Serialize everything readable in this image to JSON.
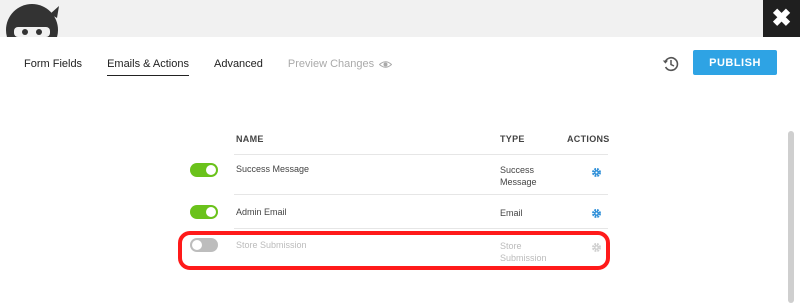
{
  "header": {
    "close_glyph": "✖"
  },
  "tabs": [
    {
      "label": "Form Fields"
    },
    {
      "label": "Emails & Actions"
    },
    {
      "label": "Advanced"
    },
    {
      "label": "Preview Changes"
    }
  ],
  "toolbar": {
    "publish_label": "PUBLISH"
  },
  "table": {
    "headers": {
      "name": "NAME",
      "type": "TYPE",
      "actions": "ACTIONS"
    },
    "rows": [
      {
        "enabled": true,
        "name": "Success Message",
        "type_line1": "Success",
        "type_line2": "Message"
      },
      {
        "enabled": true,
        "name": "Admin Email",
        "type_line1": "Email",
        "type_line2": ""
      },
      {
        "enabled": false,
        "name": "Store Submission",
        "type_line1": "Store",
        "type_line2": "Submission"
      }
    ]
  },
  "colors": {
    "accent": "#2ea3e4",
    "toggle_on": "#6ac21b",
    "toggle_off": "#bdbdbd",
    "highlight": "#ff1a1a"
  },
  "icons": [
    "ninja-logo-icon",
    "close-icon",
    "eye-icon",
    "history-icon",
    "gear-icon"
  ]
}
